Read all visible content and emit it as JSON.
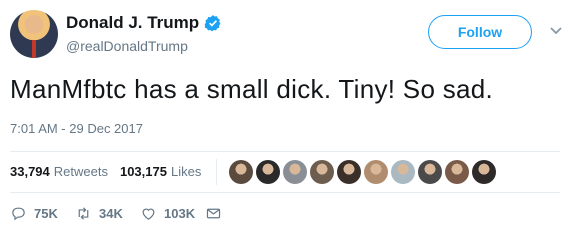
{
  "user": {
    "name": "Donald J. Trump",
    "handle": "@realDonaldTrump",
    "verified": true,
    "avatar_icon": "profile-photo"
  },
  "follow_label": "Follow",
  "tweet_text": "ManMfbtc has a small dick. Tiny! So sad.",
  "timestamp": "7:01 AM - 29 Dec 2017",
  "stats": {
    "retweets_count": "33,794",
    "retweets_label": "Retweets",
    "likes_count": "103,175",
    "likes_label": "Likes"
  },
  "likers_avatar_colors": [
    "#5b4a3e",
    "#2a2a2a",
    "#8a8f95",
    "#6d5d4f",
    "#3b2f2a",
    "#b08d6e",
    "#aab8c2",
    "#4a4a4a",
    "#7a5a48",
    "#2e2a2a"
  ],
  "actions": {
    "replies": "75K",
    "retweets": "34K",
    "likes": "103K"
  },
  "colors": {
    "accent": "#1da1f2",
    "muted": "#657786",
    "text": "#14171a"
  }
}
